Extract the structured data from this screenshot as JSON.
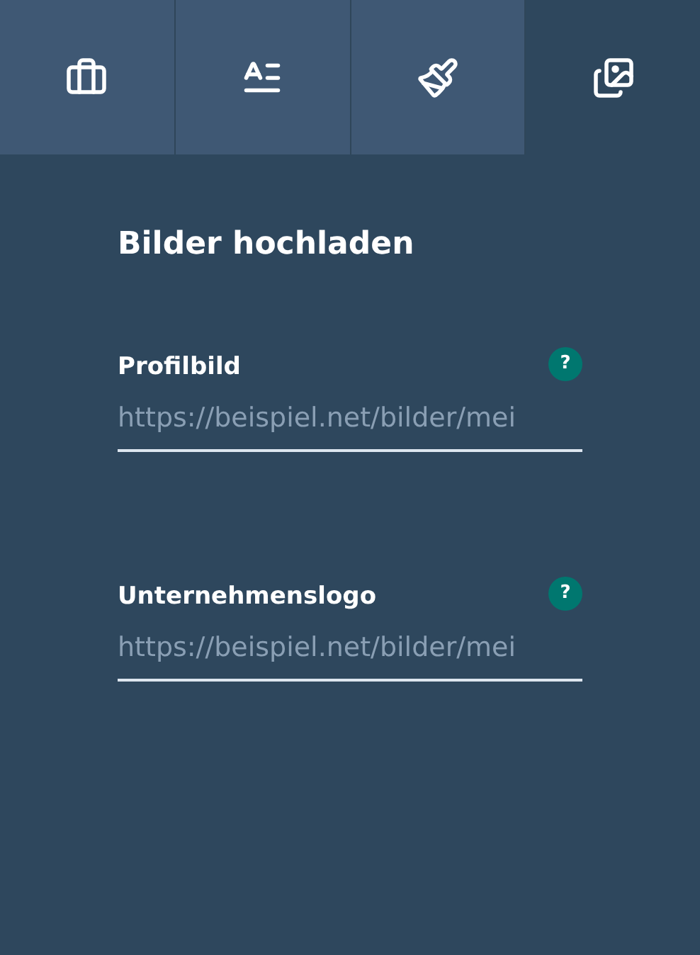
{
  "tabs": [
    {
      "kind": "briefcase",
      "selected": false
    },
    {
      "kind": "text",
      "selected": false
    },
    {
      "kind": "brush",
      "selected": false
    },
    {
      "kind": "images",
      "selected": true
    }
  ],
  "panel": {
    "title": "Bilder hochladen",
    "fields": [
      {
        "label": "Profilbild",
        "help": "?",
        "placeholder": "https://beispiel.net/bilder/mei"
      },
      {
        "label": "Unternehmenslogo",
        "help": "?",
        "placeholder": "https://beispiel.net/bilder/mei"
      }
    ]
  }
}
